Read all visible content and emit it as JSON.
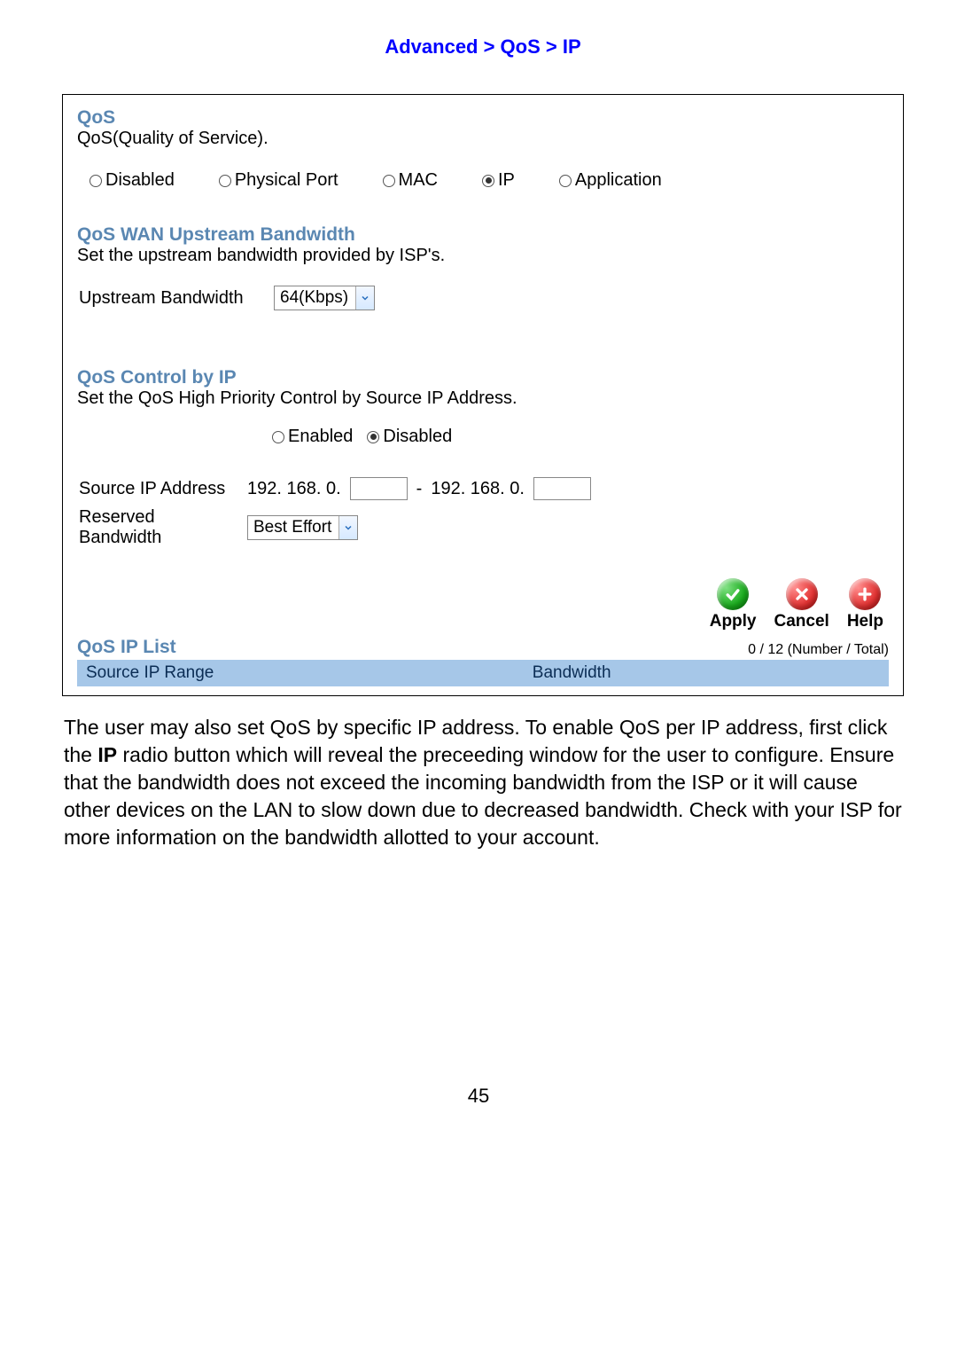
{
  "breadcrumb": "Advanced > QoS > IP",
  "qos": {
    "title": "QoS",
    "desc": "QoS(Quality of Service).",
    "modes": [
      "Disabled",
      "Physical Port",
      "MAC",
      "IP",
      "Application"
    ],
    "selected_mode": "IP"
  },
  "upstream": {
    "title": "QoS WAN Upstream Bandwidth",
    "desc": "Set the upstream bandwidth provided by ISP's.",
    "label": "Upstream Bandwidth",
    "value": "64(Kbps)"
  },
  "control": {
    "title": "QoS Control by IP",
    "desc": "Set the QoS High Priority Control by Source IP Address.",
    "enabled_label": "Enabled",
    "disabled_label": "Disabled",
    "selected": "Disabled",
    "src_label": "Source IP Address",
    "prefix1": "192. 168. 0.",
    "dash": "-",
    "prefix2": "192. 168. 0.",
    "reserved_label": "Reserved Bandwidth",
    "reserved_value": "Best Effort"
  },
  "actions": {
    "apply": "Apply",
    "cancel": "Cancel",
    "help": "Help"
  },
  "list": {
    "title": "QoS IP List",
    "count": "0 / 12 (Number / Total)",
    "col1": "Source IP Range",
    "col2": "Bandwidth"
  },
  "body": {
    "t1": "The user may also set QoS by specific IP address. To enable QoS per IP address, first click the ",
    "bold": "IP",
    "t2": " radio button which will reveal the preceeding window for the user to configure. Ensure that the bandwidth does not exceed the incoming bandwidth from the ISP or it will cause other devices on the LAN to slow down due to decreased bandwidth. Check with your ISP for more information on the bandwidth allotted to your account."
  },
  "page_number": "45"
}
